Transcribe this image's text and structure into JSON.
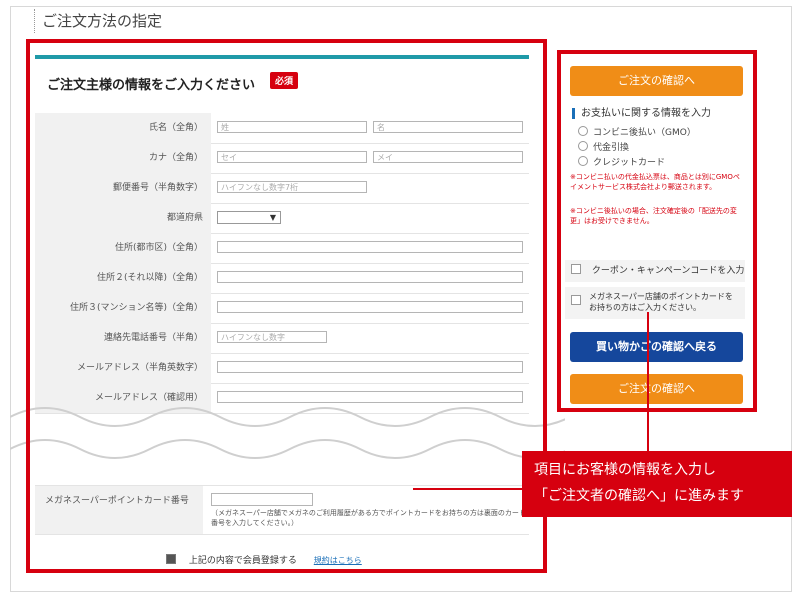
{
  "page": {
    "title": "ご注文方法の指定"
  },
  "form": {
    "heading": "ご注文主様の情報をご入力ください",
    "required_badge": "必須",
    "rows": [
      {
        "label": "氏名（全角）",
        "ph1": "姓",
        "ph2": "名"
      },
      {
        "label": "カナ（全角）",
        "ph1": "セイ",
        "ph2": "メイ"
      },
      {
        "label": "郵便番号（半角数字）",
        "ph1": "ハイフンなし数字7桁"
      },
      {
        "label": "都道府県",
        "select_value": "▼"
      },
      {
        "label": "住所(都市区)（全角）"
      },
      {
        "label": "住所２(それ以降)（全角）"
      },
      {
        "label": "住所３(マンション名等)（全角）"
      },
      {
        "label": "連絡先電話番号（半角）",
        "ph1": "ハイフンなし数字"
      },
      {
        "label": "メールアドレス（半角英数字）"
      },
      {
        "label": "メールアドレス（確認用）"
      }
    ],
    "point_card": {
      "label": "メガネスーパーポイントカード番号",
      "note": "（メガネスーパー店舗でメガネのご利用履歴がある方でポイントカードをお持ちの方は裏面のカード番号を入力してください。）"
    },
    "register": {
      "label": "上記の内容で会員登録する",
      "terms_link": "規約はこちら"
    }
  },
  "sidebar": {
    "confirm_button": "ご注文の確認へ",
    "payment_title": "お支払いに関する情報を入力",
    "payment_options": [
      "コンビニ後払い（GMO）",
      "代金引換",
      "クレジットカード"
    ],
    "notes": [
      "※コンビニ払いの代金払込票は、商品とは別にGMOペイメントサービス株式会社より郵送されます。",
      "※コンビニ後払いの場合、注文確定後の「配送先の変更」はお受けできません。"
    ],
    "coupon_label": "クーポン・キャンペーンコードを入力",
    "point_label": "メガネスーパー店舗のポイントカードをお持ちの方はご入力ください。",
    "back_button": "買い物かごの確認へ戻る",
    "confirm_button_bottom": "ご注文の確認へ"
  },
  "callout": {
    "line1": "項目にお客様の情報を入力し",
    "line2": "「ご注文者の確認へ」に進みます"
  },
  "colors": {
    "accent_red": "#d6000f",
    "orange": "#f08d17",
    "blue": "#15479c",
    "teal": "#1f9aa8"
  }
}
